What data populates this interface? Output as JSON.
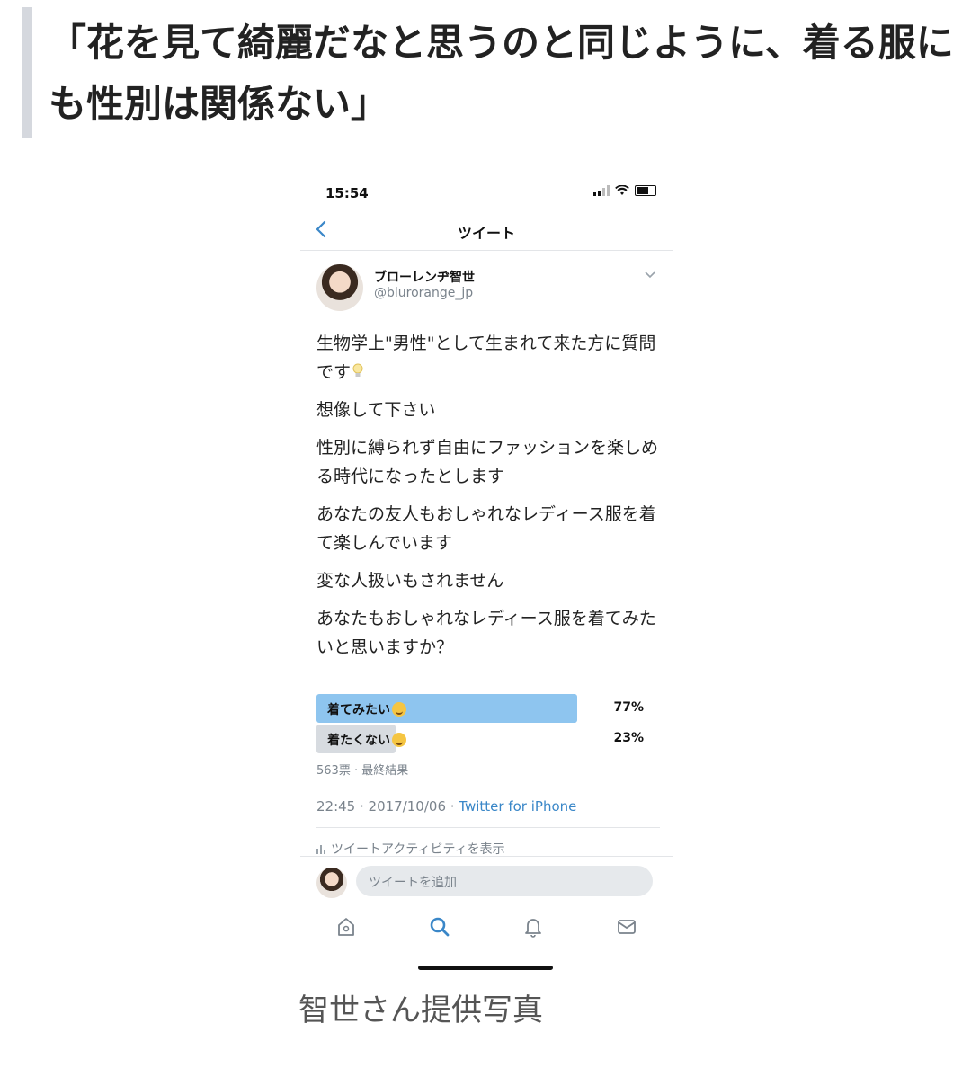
{
  "article": {
    "heading": "「花を見て綺麗だなと思うのと同じように、着る服にも性別は関係ない」",
    "caption": "智世さん提供写真"
  },
  "screenshot": {
    "status_time": "15:54",
    "nav_title": "ツイート",
    "user": {
      "name": "ブローレンヂ智世",
      "handle": "@blurorange_jp"
    },
    "tweet_paragraphs": [
      "生物学上\"男性\"として生まれて来た方に質問です",
      "想像して下さい",
      "性別に縛られず自由にファッションを楽しめる時代になったとします",
      "あなたの友人もおしゃれなレディース服を着て楽しんでいます",
      "変な人扱いもされません",
      "あなたもおしゃれなレディース服を着てみたいと思いますか？"
    ],
    "poll": {
      "options": [
        {
          "label": "着てみたい",
          "percent_text": "77%",
          "share": 0.77,
          "winner": true
        },
        {
          "label": "着たくない",
          "percent_text": "23%",
          "share": 0.23,
          "winner": false
        }
      ],
      "meta": "563票 · 最終結果"
    },
    "timestamp": "22:45 · 2017/10/06 · ",
    "source": "Twitter for iPhone",
    "activity": "ツイートアクティビティを表示",
    "reply_placeholder": "ツイートを追加",
    "tabs": [
      "home-icon",
      "search-icon",
      "bell-icon",
      "mail-icon"
    ],
    "colors": {
      "accent": "#3a87c8",
      "poll_winner": "#8ec5ef",
      "poll_loser": "#d7dbe0"
    }
  }
}
